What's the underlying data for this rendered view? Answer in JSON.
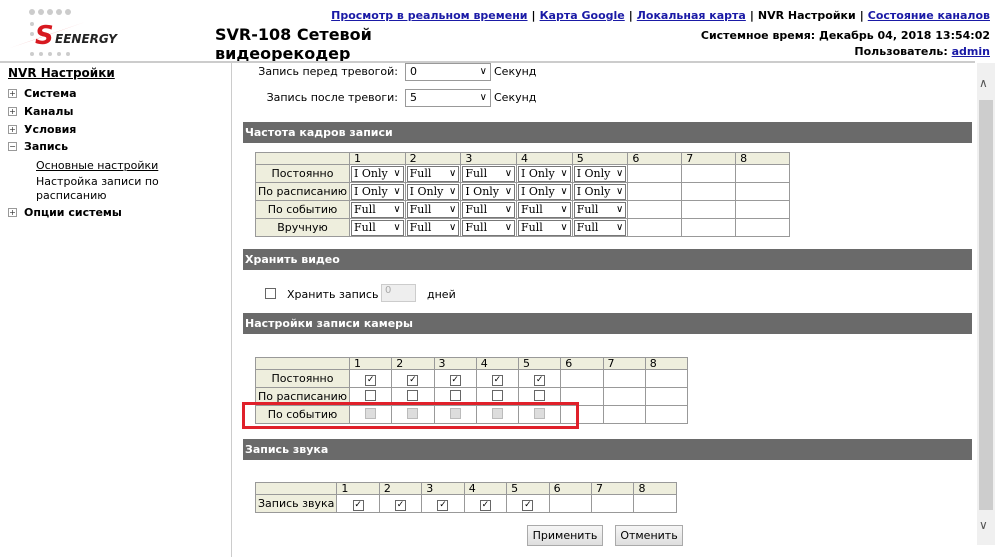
{
  "header": {
    "logo_text": "SEENERGY",
    "title_line1": "SVR-108 Сетевой",
    "title_line2": "видеорекодер",
    "links": [
      "Просмотр в реальном времени",
      "Карта Google",
      "Локальная карта",
      "NVR Настройки",
      "Состояние каналов"
    ],
    "system_time": "Системное время: Декабрь 04, 2018 13:54:02",
    "user_label": "Пользователь:",
    "user": "admin"
  },
  "sidebar": {
    "title": "NVR Настройки",
    "items": [
      "Система",
      "Каналы",
      "Условия",
      "Запись",
      "Опции системы"
    ],
    "subitems": [
      "Основные настройки",
      "Настройка записи по расписанию"
    ]
  },
  "prealarm": {
    "label": "Запись перед тревогой:",
    "value": "0",
    "unit": "Секунд"
  },
  "postalarm": {
    "label": "Запись после тревоги:",
    "value": "5",
    "unit": "Секунд"
  },
  "sections": {
    "framerate": "Частота кадров записи",
    "keep": "Хранить видео",
    "camera": "Настройки записи камеры",
    "audio": "Запись звука"
  },
  "channels": [
    "1",
    "2",
    "3",
    "4",
    "5",
    "6",
    "7",
    "8"
  ],
  "framerate_rows": [
    {
      "label": "Постоянно",
      "values": [
        "I Only",
        "Full",
        "Full",
        "I Only",
        "I Only"
      ]
    },
    {
      "label": "По расписанию",
      "values": [
        "I Only",
        "I Only",
        "I Only",
        "I Only",
        "I Only"
      ]
    },
    {
      "label": "По событию",
      "values": [
        "Full",
        "Full",
        "Full",
        "Full",
        "Full"
      ]
    },
    {
      "label": "Вручную",
      "values": [
        "Full",
        "Full",
        "Full",
        "Full",
        "Full"
      ]
    }
  ],
  "keep": {
    "label": "Хранить запись",
    "value": "0",
    "unit": "дней",
    "checked": false
  },
  "camera_rows": [
    {
      "label": "Постоянно",
      "state": "checked"
    },
    {
      "label": "По расписанию",
      "state": "unchecked"
    },
    {
      "label": "По событию",
      "state": "disabled"
    }
  ],
  "audio_row": {
    "label": "Запись звука",
    "state": "checked"
  },
  "buttons": {
    "apply": "Применить",
    "cancel": "Отменить"
  },
  "colors": {
    "section_bg": "#6a6a6a",
    "highlight": "#e0202a",
    "link": "#1a1aa6"
  }
}
